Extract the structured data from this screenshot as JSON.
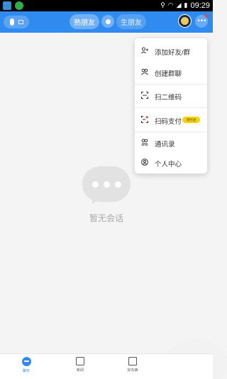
{
  "status_bar": {
    "time": "09:29"
  },
  "header": {
    "tab_familiar": "熟朋友",
    "tab_stranger": "生朋友"
  },
  "empty_state": {
    "text": "暂无会话"
  },
  "menu": {
    "items": [
      {
        "label": "添加好友/群",
        "icon": "add-user-icon"
      },
      {
        "label": "创建群聊",
        "icon": "group-icon"
      },
      {
        "label": "扫二维码",
        "icon": "scan-icon"
      },
      {
        "label": "扫码支付",
        "icon": "scan-pay-icon",
        "badge": "限时送"
      },
      {
        "label": "通讯录",
        "icon": "contacts-icon"
      },
      {
        "label": "个人中心",
        "icon": "profile-icon"
      }
    ]
  },
  "bottom_nav": {
    "items": [
      {
        "label": "聊天",
        "icon": "chat-icon",
        "active": true
      },
      {
        "label": "新闻",
        "icon": "news-icon",
        "active": false
      },
      {
        "label": "好东西",
        "icon": "shopping-bag-icon",
        "active": false
      }
    ]
  },
  "colors": {
    "accent": "#2f8bf0",
    "badge": "#f6d400",
    "notification": "#e84a3c"
  }
}
